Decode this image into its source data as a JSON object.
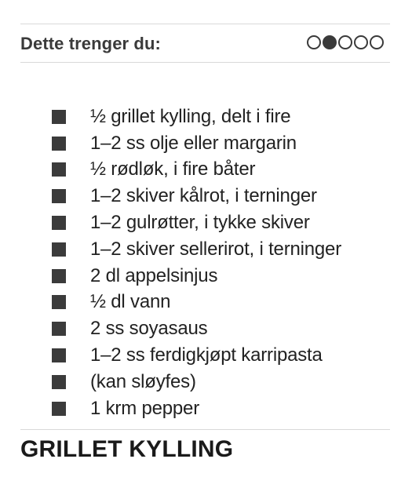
{
  "header": {
    "title": "Dette trenger du:",
    "difficulty": {
      "level": 2,
      "max": 5
    }
  },
  "ingredients": [
    "½ grillet kylling, delt i fire",
    "1–2 ss olje eller margarin",
    "½ rødløk, i fire båter",
    "1–2 skiver kålrot, i terninger",
    "1–2 gulrøtter, i tykke skiver",
    "1–2 skiver sellerirot, i terninger",
    "2 dl appelsinjus",
    "½ dl vann",
    "2 ss soyasaus",
    "1–2 ss ferdigkjøpt karripasta",
    "(kan sløyfes)",
    "1 krm pepper"
  ],
  "recipe": {
    "title": "GRILLET KYLLING"
  }
}
